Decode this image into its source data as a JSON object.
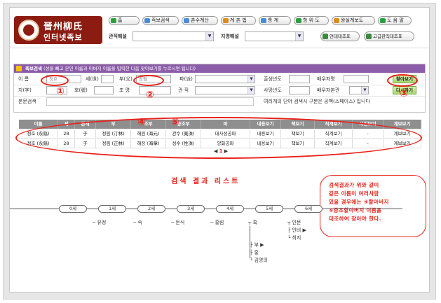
{
  "header": {
    "logo_line1": "晉州柳氏",
    "logo_line2": "인터넷족보",
    "nav": [
      "홈",
      "족보검색",
      "촌수계산",
      "계 촌 법",
      "통 계",
      "항 위 도",
      "왕실계보도",
      "도 움 말"
    ],
    "filter1_label": "관직해설",
    "filter2_label": "지명해설",
    "btn_chronology": "연대대조표",
    "btn_official": "고급관직대조표"
  },
  "search": {
    "title_bold": "족보검색",
    "title_rest": "(성을 빼고 본인 이름과 아버지 이름을 입력한 다음 찾아보기를 누르시면 됩니다)",
    "f_name_label": "이 름",
    "f_name_placeholder": "정호",
    "f_gen_label": "세(世)",
    "f_father_label": "부(父)",
    "f_father_placeholder": "정림",
    "f_branch_label": "파(派)",
    "f_birth_label": "출생년도",
    "f_spouse_label": "배우자명",
    "f_ja_label": "자(字)",
    "f_ho_label": "호(號)",
    "f_chomyeong_label": "초 명",
    "f_gwanjik_label": "관 직",
    "f_death_label": "사망년도",
    "f_spouse_clan_label": "배우자본관",
    "f_body_label": "본문검색",
    "btn_search": "찾아보기",
    "btn_reset": "다시하기",
    "note": "여러개의 단어 검색시 구분은 공백(스페이스) 입니다"
  },
  "results": {
    "columns": [
      "이름",
      "세",
      "관계",
      "부",
      "조부",
      "증조부",
      "파",
      "내용보기",
      "책보기",
      "직계보기",
      "사진보기",
      "계보보기"
    ],
    "rows": [
      [
        "정호 (永鎬)",
        "28",
        "子",
        "정림 (汀林)",
        "해원 (海元)",
        "관수 (寬洙)",
        "대사성공파",
        "내용보기",
        "책보기",
        "직계보기",
        "-",
        "계보보기"
      ],
      [
        "정호 (永鎬)",
        "28",
        "子",
        "정림 (正林)",
        "해장 (海章)",
        "성수 (性洙)",
        "양화공파",
        "내용보기",
        "책보기",
        "직계보기",
        "-",
        "계보보기"
      ]
    ],
    "pager_prev": "◀",
    "pager_page": "1",
    "pager_next": "▶"
  },
  "result_title": "검색 결과 리스트",
  "callout": [
    "검색결과가 위와 같이",
    "같은 이름이 여러사람",
    "있을 경우에는 ④할아버지",
    "⑤증조할아버지 이름을",
    "대조하여 찾아야 한다."
  ],
  "annotations": [
    "①",
    "②",
    "③",
    "④",
    "⑤"
  ],
  "timeline": {
    "generations": [
      "0세",
      "1세",
      "2세",
      "3세",
      "4세",
      "5세",
      "6세"
    ],
    "names": [
      "유정",
      "숙",
      "돈식",
      "홍림",
      "훅",
      "인문",
      "인비 ▶",
      "최지",
      "부 ▶",
      "홍",
      "김명의"
    ]
  }
}
